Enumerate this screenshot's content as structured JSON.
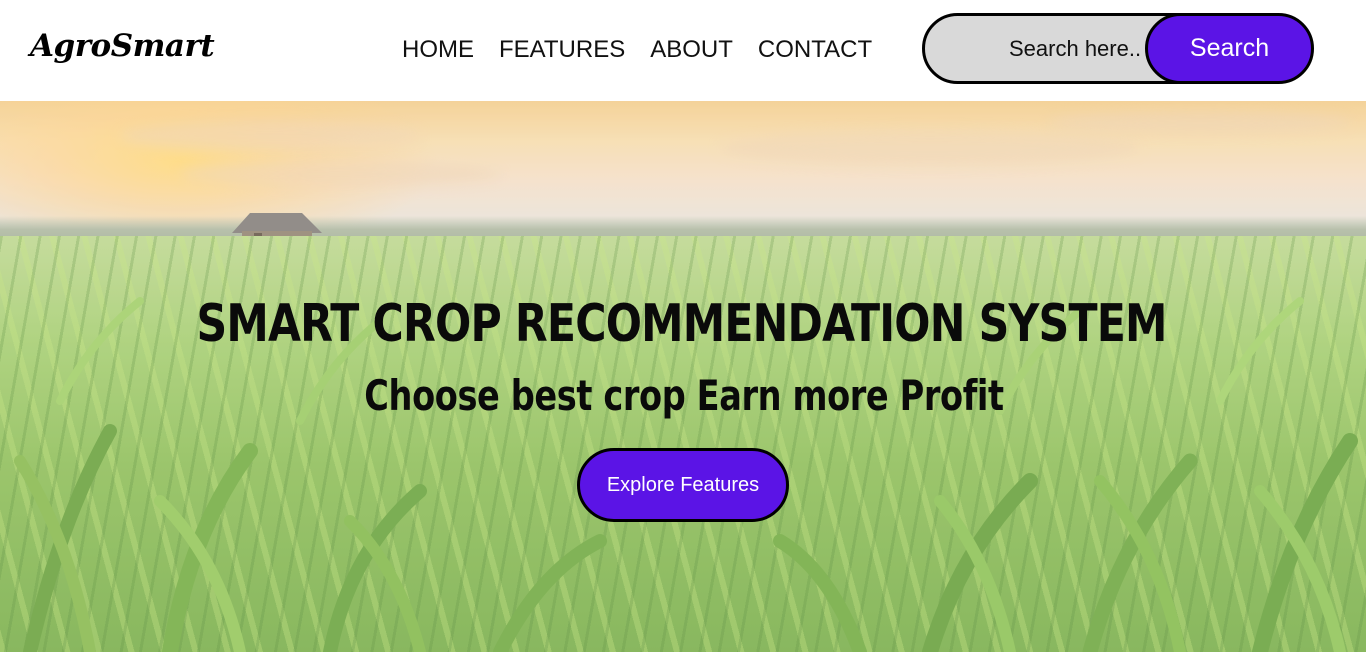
{
  "brand": {
    "name": "AgroSmart"
  },
  "nav": {
    "items": [
      {
        "label": "HOME"
      },
      {
        "label": "FEATURES"
      },
      {
        "label": "ABOUT"
      },
      {
        "label": "CONTACT"
      }
    ]
  },
  "search": {
    "placeholder": "Search here..",
    "value": "",
    "button_label": "Search"
  },
  "hero": {
    "title": "SMART CROP RECOMMENDATION SYSTEM",
    "subtitle": "Choose best crop Earn more Profit",
    "cta_label": "Explore Features",
    "background_icon": "cornfield-sunrise-image"
  },
  "colors": {
    "accent": "#5b14e6",
    "search_field": "#d9d9d9",
    "text": "#0a0a0a",
    "header_bg": "#ffffff"
  }
}
